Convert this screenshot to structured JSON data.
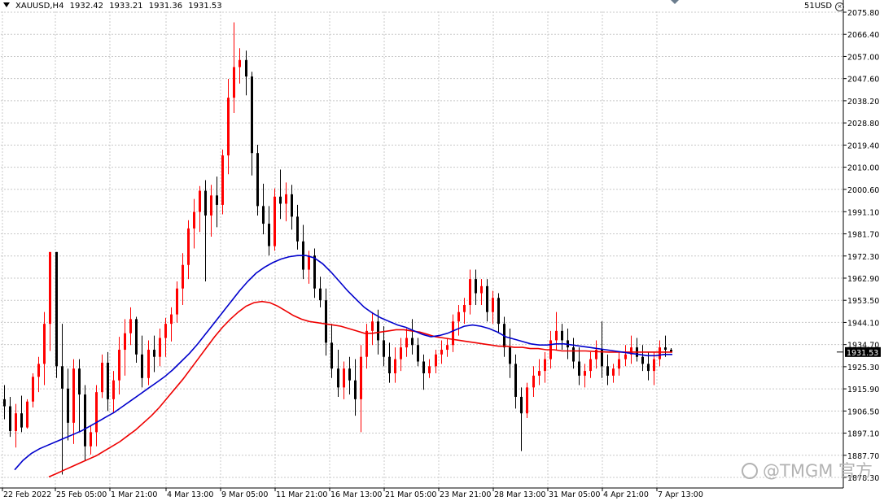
{
  "header": {
    "symbol": "XAUUSD,H4",
    "open": "1932.42",
    "high": "1933.21",
    "low": "1931.36",
    "close": "1931.53",
    "account": "51USD"
  },
  "watermark": "@TMGM 官方",
  "chart_data": {
    "type": "candlestick",
    "symbol": "XAUUSD",
    "timeframe": "H4",
    "ylim": [
      1878.3,
      2079.0
    ],
    "y_ticks": [
      "2075.80",
      "2066.40",
      "2057.00",
      "2047.60",
      "2038.20",
      "2028.80",
      "2019.40",
      "2010.00",
      "2000.60",
      "1991.10",
      "1981.70",
      "1972.30",
      "1962.90",
      "1953.50",
      "1944.10",
      "1934.70",
      "1925.30",
      "1915.90",
      "1906.50",
      "1897.10",
      "1887.70",
      "1878.30"
    ],
    "x_ticks": [
      "22 Feb 2022",
      "25 Feb 05:00",
      "1 Mar 21:00",
      "4 Mar 13:00",
      "9 Mar 05:00",
      "11 Mar 21:00",
      "16 Mar 13:00",
      "21 Mar 05:00",
      "23 Mar 21:00",
      "28 Mar 13:00",
      "31 Mar 05:00",
      "4 Apr 21:00",
      "7 Apr 13:00"
    ],
    "last_price": "1931.53",
    "colors": {
      "bull": "#ff0000",
      "bear": "#000000",
      "ma_fast": "#0000cc",
      "ma_slow": "#ee0000",
      "grid": "#c8c8c8",
      "price_tag_bg": "#000000"
    },
    "grid": true,
    "candles": [
      [
        1911.5,
        1917.5,
        1903.0,
        1908.5
      ],
      [
        1908.5,
        1912.5,
        1895.5,
        1898.0
      ],
      [
        1898.0,
        1909.5,
        1891.0,
        1905.5
      ],
      [
        1905.5,
        1913.0,
        1897.5,
        1899.5
      ],
      [
        1899.5,
        1911.5,
        1899.0,
        1910.5
      ],
      [
        1910.5,
        1922.5,
        1908.0,
        1921.0
      ],
      [
        1921.0,
        1929.5,
        1914.5,
        1926.5
      ],
      [
        1926.5,
        1948.5,
        1917.5,
        1943.5
      ],
      [
        1943.5,
        1974.0,
        1932.0,
        1974.0
      ],
      [
        1974.0,
        1974.0,
        1920.5,
        1925.5
      ],
      [
        1925.5,
        1943.5,
        1879.5,
        1916.0
      ],
      [
        1916.0,
        1924.5,
        1894.0,
        1901.5
      ],
      [
        1901.5,
        1928.5,
        1892.5,
        1924.5
      ],
      [
        1924.5,
        1928.5,
        1897.5,
        1913.5
      ],
      [
        1913.5,
        1917.5,
        1885.5,
        1891.5
      ],
      [
        1891.5,
        1900.5,
        1888.0,
        1897.5
      ],
      [
        1897.5,
        1917.5,
        1891.5,
        1914.5
      ],
      [
        1914.5,
        1930.5,
        1912.0,
        1927.0
      ],
      [
        1927.0,
        1931.5,
        1906.5,
        1911.5
      ],
      [
        1911.5,
        1923.5,
        1905.5,
        1919.5
      ],
      [
        1919.5,
        1938.0,
        1913.5,
        1932.5
      ],
      [
        1932.5,
        1945.5,
        1921.5,
        1939.5
      ],
      [
        1939.5,
        1950.5,
        1934.5,
        1945.5
      ],
      [
        1945.5,
        1946.5,
        1927.0,
        1930.5
      ],
      [
        1930.5,
        1938.5,
        1916.5,
        1920.5
      ],
      [
        1920.5,
        1936.5,
        1917.5,
        1932.5
      ],
      [
        1932.5,
        1938.5,
        1923.0,
        1929.5
      ],
      [
        1929.5,
        1941.5,
        1925.5,
        1937.5
      ],
      [
        1937.5,
        1946.0,
        1929.5,
        1943.5
      ],
      [
        1943.5,
        1950.5,
        1936.0,
        1947.5
      ],
      [
        1947.5,
        1961.5,
        1944.0,
        1958.5
      ],
      [
        1958.5,
        1973.5,
        1951.5,
        1968.5
      ],
      [
        1968.5,
        1987.5,
        1962.5,
        1984.0
      ],
      [
        1984.0,
        1996.5,
        1975.5,
        1991.0
      ],
      [
        1991.0,
        2002.0,
        1982.5,
        2000.0
      ],
      [
        2000.0,
        2004.5,
        1961.5,
        1989.5
      ],
      [
        1989.5,
        2002.5,
        1980.5,
        1998.0
      ],
      [
        1998.0,
        2006.0,
        1984.5,
        1994.0
      ],
      [
        1994.0,
        2017.5,
        1990.0,
        2015.0
      ],
      [
        2015.0,
        2047.5,
        2007.0,
        2039.5
      ],
      [
        2039.5,
        2071.5,
        2033.0,
        2052.5
      ],
      [
        2052.5,
        2060.5,
        2045.5,
        2055.5
      ],
      [
        2055.5,
        2059.5,
        2040.5,
        2048.5
      ],
      [
        2048.5,
        2050.5,
        2006.5,
        2016.0
      ],
      [
        2016.0,
        2019.5,
        1989.5,
        1993.5
      ],
      [
        1993.5,
        2003.0,
        1981.5,
        1986.0
      ],
      [
        1986.0,
        1993.5,
        1972.5,
        1976.5
      ],
      [
        1976.5,
        2001.0,
        1974.5,
        1997.5
      ],
      [
        1997.5,
        2009.0,
        1988.0,
        1994.5
      ],
      [
        1994.5,
        2003.5,
        1987.0,
        1998.5
      ],
      [
        1998.5,
        2002.5,
        1983.5,
        1989.0
      ],
      [
        1989.0,
        1994.0,
        1975.0,
        1978.5
      ],
      [
        1978.5,
        1985.5,
        1962.5,
        1966.5
      ],
      [
        1966.5,
        1974.5,
        1960.5,
        1972.5
      ],
      [
        1972.5,
        1975.5,
        1954.5,
        1958.5
      ],
      [
        1958.5,
        1963.5,
        1950.5,
        1953.5
      ],
      [
        1953.5,
        1958.5,
        1930.0,
        1935.5
      ],
      [
        1935.5,
        1943.5,
        1920.5,
        1924.5
      ],
      [
        1924.5,
        1932.5,
        1912.5,
        1916.5
      ],
      [
        1916.5,
        1927.5,
        1911.5,
        1924.5
      ],
      [
        1924.5,
        1929.5,
        1913.5,
        1919.5
      ],
      [
        1919.5,
        1928.5,
        1904.5,
        1911.5
      ],
      [
        1911.5,
        1934.5,
        1897.5,
        1929.5
      ],
      [
        1929.5,
        1943.5,
        1924.5,
        1940.5
      ],
      [
        1940.5,
        1948.5,
        1934.5,
        1944.5
      ],
      [
        1944.5,
        1949.5,
        1930.5,
        1936.5
      ],
      [
        1936.5,
        1942.5,
        1925.5,
        1929.5
      ],
      [
        1929.5,
        1935.5,
        1918.5,
        1922.5
      ],
      [
        1922.5,
        1933.5,
        1918.5,
        1928.5
      ],
      [
        1928.5,
        1937.5,
        1923.5,
        1933.5
      ],
      [
        1933.5,
        1941.5,
        1929.5,
        1937.5
      ],
      [
        1937.5,
        1945.5,
        1930.5,
        1934.5
      ],
      [
        1934.5,
        1937.5,
        1925.5,
        1927.5
      ],
      [
        1927.5,
        1930.5,
        1915.5,
        1922.5
      ],
      [
        1922.5,
        1928.5,
        1920.5,
        1925.5
      ],
      [
        1925.5,
        1932.5,
        1922.5,
        1930.5
      ],
      [
        1930.5,
        1936.5,
        1926.5,
        1932.5
      ],
      [
        1932.5,
        1937.5,
        1929.5,
        1934.5
      ],
      [
        1934.5,
        1947.5,
        1931.5,
        1944.5
      ],
      [
        1944.5,
        1951.5,
        1938.5,
        1948.5
      ],
      [
        1948.5,
        1954.5,
        1943.5,
        1951.5
      ],
      [
        1951.5,
        1966.5,
        1947.5,
        1962.5
      ],
      [
        1962.5,
        1966.5,
        1951.5,
        1956.5
      ],
      [
        1956.5,
        1962.5,
        1951.5,
        1959.5
      ],
      [
        1959.5,
        1962.5,
        1944.5,
        1948.5
      ],
      [
        1948.5,
        1957.5,
        1943.5,
        1954.5
      ],
      [
        1954.5,
        1956.5,
        1939.5,
        1943.5
      ],
      [
        1943.5,
        1946.5,
        1929.5,
        1933.5
      ],
      [
        1933.5,
        1941.5,
        1920.5,
        1926.5
      ],
      [
        1926.5,
        1930.5,
        1907.5,
        1912.5
      ],
      [
        1912.5,
        1916.5,
        1889.5,
        1905.5
      ],
      [
        1905.5,
        1918.5,
        1903.5,
        1916.5
      ],
      [
        1916.5,
        1925.5,
        1912.5,
        1921.5
      ],
      [
        1921.5,
        1928.5,
        1917.5,
        1923.5
      ],
      [
        1923.5,
        1931.5,
        1918.5,
        1928.5
      ],
      [
        1928.5,
        1940.5,
        1924.5,
        1936.5
      ],
      [
        1936.5,
        1948.5,
        1932.5,
        1940.5
      ],
      [
        1940.5,
        1943.5,
        1932.5,
        1936.5
      ],
      [
        1936.5,
        1941.5,
        1928.5,
        1933.5
      ],
      [
        1933.5,
        1937.5,
        1924.5,
        1927.5
      ],
      [
        1927.5,
        1933.5,
        1917.5,
        1921.5
      ],
      [
        1921.5,
        1926.5,
        1916.5,
        1923.5
      ],
      [
        1923.5,
        1931.5,
        1920.5,
        1928.5
      ],
      [
        1928.5,
        1936.5,
        1924.5,
        1932.5
      ],
      [
        1932.5,
        1944.5,
        1920.5,
        1925.5
      ],
      [
        1925.5,
        1930.5,
        1917.5,
        1921.5
      ],
      [
        1921.5,
        1926.5,
        1918.5,
        1924.5
      ],
      [
        1924.5,
        1931.5,
        1921.5,
        1928.5
      ],
      [
        1928.5,
        1934.5,
        1925.5,
        1930.5
      ],
      [
        1930.5,
        1938.5,
        1926.5,
        1933.5
      ],
      [
        1933.5,
        1937.5,
        1927.5,
        1929.5
      ],
      [
        1929.5,
        1934.5,
        1923.5,
        1926.5
      ],
      [
        1926.5,
        1931.5,
        1919.5,
        1923.5
      ],
      [
        1923.5,
        1931.5,
        1917.5,
        1928.5
      ],
      [
        1928.5,
        1936.5,
        1925.5,
        1933.5
      ],
      [
        1933.5,
        1938.5,
        1929.5,
        1932.5
      ],
      [
        1932.5,
        1933.2,
        1931.4,
        1931.5
      ]
    ],
    "ma_fast": [
      1881.5,
      1885.5,
      1888.5,
      1890.5,
      1892.0,
      1893.5,
      1895.0,
      1896.5,
      1898.0,
      1900.0,
      1902.0,
      1904.0,
      1906.0,
      1908.5,
      1911.0,
      1913.5,
      1916.0,
      1918.5,
      1921.0,
      1924.0,
      1927.5,
      1931.0,
      1935.0,
      1939.5,
      1944.0,
      1948.5,
      1953.0,
      1957.5,
      1961.5,
      1965.0,
      1967.5,
      1969.5,
      1971.0,
      1972.0,
      1972.5,
      1972.5,
      1971.5,
      1969.0,
      1965.5,
      1961.5,
      1957.5,
      1954.0,
      1950.5,
      1948.0,
      1946.0,
      1944.5,
      1943.0,
      1942.0,
      1940.5,
      1939.0,
      1938.0,
      1938.5,
      1939.5,
      1941.0,
      1942.5,
      1943.0,
      1942.5,
      1941.5,
      1940.0,
      1938.0,
      1937.0,
      1936.0,
      1935.0,
      1934.5,
      1934.5,
      1935.0,
      1935.0,
      1934.5,
      1934.0,
      1933.5,
      1933.0,
      1932.5,
      1932.0,
      1931.5,
      1931.0,
      1930.5,
      1930.0,
      1930.0,
      1930.5,
      1930.5
    ],
    "ma_slow": [
      1878.5,
      1880.0,
      1881.5,
      1883.0,
      1884.5,
      1886.0,
      1887.5,
      1889.5,
      1891.5,
      1893.5,
      1896.0,
      1898.5,
      1901.5,
      1904.5,
      1908.0,
      1912.0,
      1916.0,
      1920.0,
      1924.5,
      1929.0,
      1933.5,
      1938.0,
      1942.0,
      1945.5,
      1948.5,
      1951.0,
      1952.5,
      1953.0,
      1952.5,
      1951.0,
      1949.0,
      1947.0,
      1945.5,
      1944.5,
      1944.0,
      1943.5,
      1943.0,
      1942.5,
      1941.5,
      1940.5,
      1939.5,
      1939.5,
      1940.0,
      1940.5,
      1941.0,
      1941.0,
      1940.5,
      1940.0,
      1939.0,
      1938.0,
      1937.5,
      1937.0,
      1936.5,
      1936.0,
      1935.5,
      1935.0,
      1934.5,
      1934.0,
      1934.0,
      1933.5,
      1933.5,
      1933.0,
      1933.0,
      1932.5,
      1932.5,
      1932.0,
      1932.0,
      1932.0,
      1932.0,
      1931.8,
      1931.6,
      1931.5,
      1931.5,
      1931.5,
      1931.5,
      1931.5,
      1931.5,
      1931.5,
      1931.5,
      1931.5
    ]
  }
}
